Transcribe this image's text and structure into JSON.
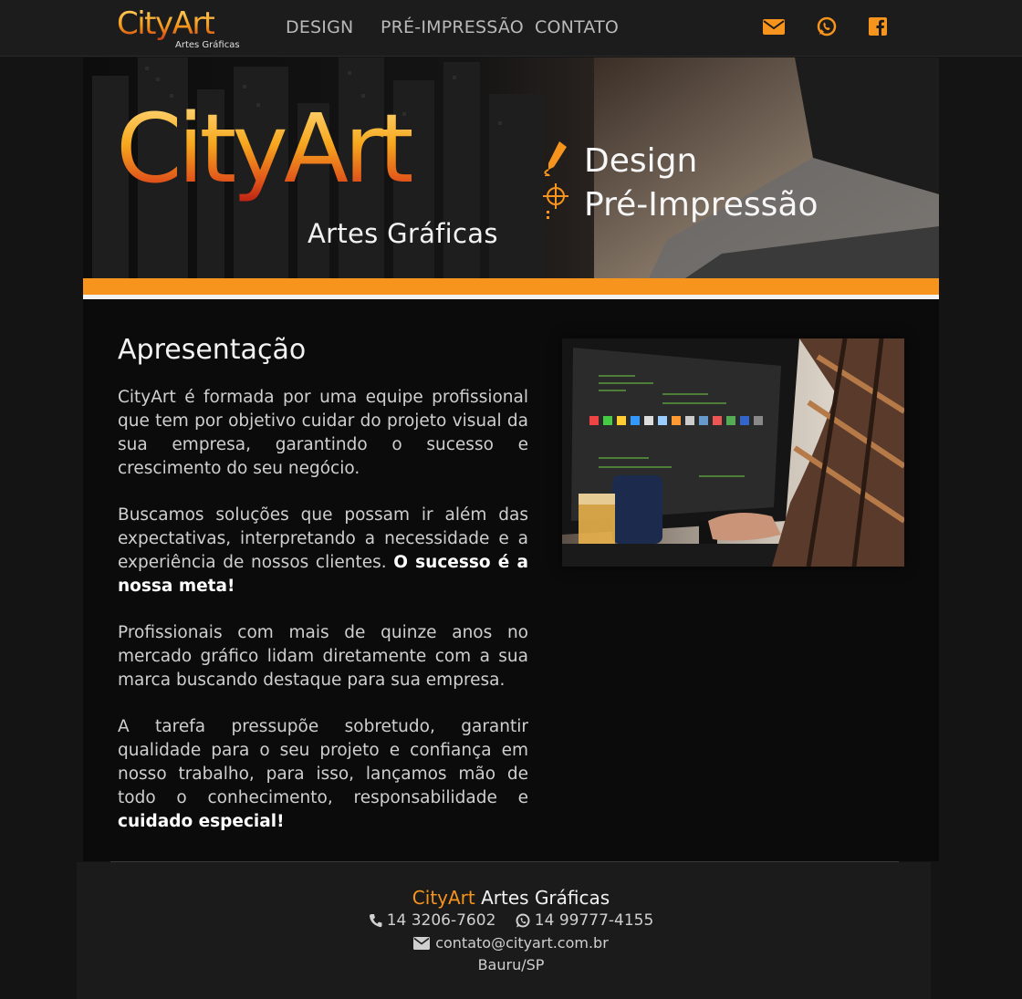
{
  "header": {
    "logo_text": "CityArt",
    "logo_sub": "Artes Gráficas",
    "nav": [
      {
        "label": "DESIGN"
      },
      {
        "label": "PRÉ-IMPRESSÃO"
      },
      {
        "label": "CONTATO"
      }
    ],
    "social_icons": [
      "envelope-icon",
      "whatsapp-icon",
      "facebook-icon"
    ]
  },
  "banner": {
    "logo_text": "CityArt",
    "logo_sub": "Artes Gráficas",
    "services": [
      "Design",
      "Pré-Impressão"
    ],
    "accent_color": "#f7941d"
  },
  "main": {
    "heading": "Apresentação",
    "paragraphs": [
      {
        "text": "CityArt é formada por uma equipe profissional que tem por objetivo cuidar do projeto visual da sua empresa, garantindo o sucesso e crescimento do seu negócio."
      },
      {
        "text": "Buscamos soluções que possam ir além das expectativas, interpretando a necessidade e a experiência de nossos clientes. ",
        "bold": "O sucesso é a nossa meta!"
      },
      {
        "text": "Profissionais com mais de quinze anos no mercado gráfico lidam diretamente com a sua marca buscando destaque para sua empresa."
      },
      {
        "text": "A tarefa pressupõe sobretudo, garantir qualidade para o seu projeto e confiança em nosso trabalho, para isso, lançamos mão de todo o conhecimento, responsabilidade e ",
        "bold": "cuidado especial!"
      }
    ]
  },
  "footer": {
    "brand_orange": "CityArt",
    "brand_rest": "Artes Gráficas",
    "phone": "14 3206-7602",
    "whatsapp": "14 99777-4155",
    "email": "contato@cityart.com.br",
    "city": "Bauru/SP"
  }
}
